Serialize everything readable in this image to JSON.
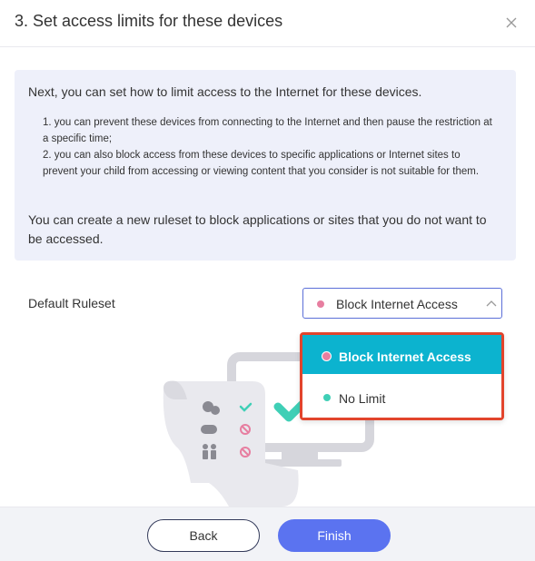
{
  "dialog": {
    "title": "3. Set access limits for these devices"
  },
  "info": {
    "intro": "Next, you can set how to limit access to the Internet for these devices.",
    "items": [
      "1. you can prevent these devices from connecting to the Internet and then pause the restriction at a specific time;",
      "2. you can also block access from these devices to specific applications or Internet sites to prevent your child from accessing or viewing content that you consider is not suitable for them."
    ],
    "outro": "You can create a new ruleset to block applications or sites that you do not want to be accessed."
  },
  "ruleset": {
    "label": "Default Ruleset",
    "selected": "Block Internet Access",
    "options": [
      {
        "label": "Block Internet Access",
        "dot_color": "#e77ea0"
      },
      {
        "label": "No Limit",
        "dot_color": "#3fcfb6"
      }
    ]
  },
  "footer": {
    "back_label": "Back",
    "finish_label": "Finish"
  },
  "colors": {
    "accent": "#5b73f0",
    "highlight": "#0cb3cf",
    "annotation_border": "#e2442c"
  }
}
